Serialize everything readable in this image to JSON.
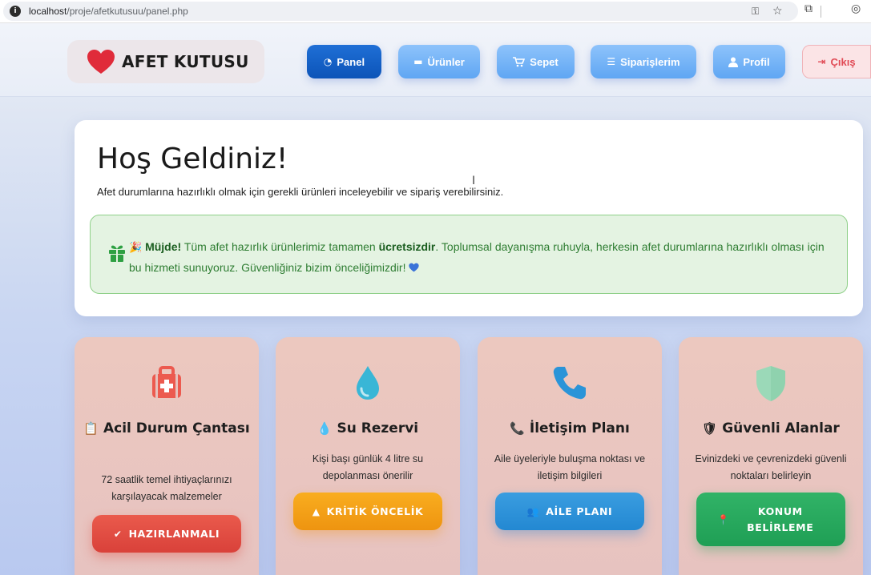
{
  "browser": {
    "url_host": "localhost",
    "url_path": "/proje/afetkutusuu/panel.php",
    "icons": [
      "info-icon",
      "password-key-icon",
      "bookmark-star-icon",
      "extensions-icon",
      "profile-icon"
    ]
  },
  "brand": {
    "name": "AFET KUTUSU",
    "heart_color": "#e02b3a"
  },
  "nav": {
    "panel": "Panel",
    "urunler": "Ürünler",
    "sepet": "Sepet",
    "siparislerim": "Siparişlerim",
    "profil": "Profil",
    "cikis": "Çıkış"
  },
  "welcome": {
    "title": "Hoş Geldiniz!",
    "subtitle": "Afet durumlarına hazırlıklı olmak için gerekli ürünleri inceleyebilir ve sipariş verebilirsiniz.",
    "notice": {
      "strong_1": "Müjde!",
      "text_1": " Tüm afet hazırlık ürünlerimiz tamamen ",
      "strong_2": "ücretsizdir",
      "text_2": ". Toplumsal dayanışma ruhuyla, herkesin afet durumlarına hazırlıklı olması için bu hizmeti sunuyoruz. Güvenliğiniz bizim önceliğimizdir!"
    }
  },
  "cards": [
    {
      "title": "Acil Durum Çantası",
      "description": "72 saatlik temel ihtiyaçlarınızı karşılayacak malzemeler",
      "button": "HAZIRLANMALI",
      "icon": "first-aid-kit-icon",
      "color": "#ec5a4f"
    },
    {
      "title": "Su Rezervi",
      "description": "Kişi başı günlük 4 litre su depolanması önerilir",
      "button": "KRİTİK ÖNCELİK",
      "icon": "water-drop-icon",
      "color": "#39b6d6"
    },
    {
      "title": "İletişim Planı",
      "description": "Aile üyeleriyle buluşma noktası ve iletişim bilgileri",
      "button": "AİLE PLANI",
      "icon": "phone-icon",
      "color": "#2a94d8"
    },
    {
      "title": "Güvenli Alanlar",
      "description": "Evinizdeki ve çevrenizdeki güvenli noktaları belirleyin",
      "button": "KONUM BELİRLEME",
      "icon": "shield-icon",
      "color": "#9bd9b8"
    }
  ]
}
